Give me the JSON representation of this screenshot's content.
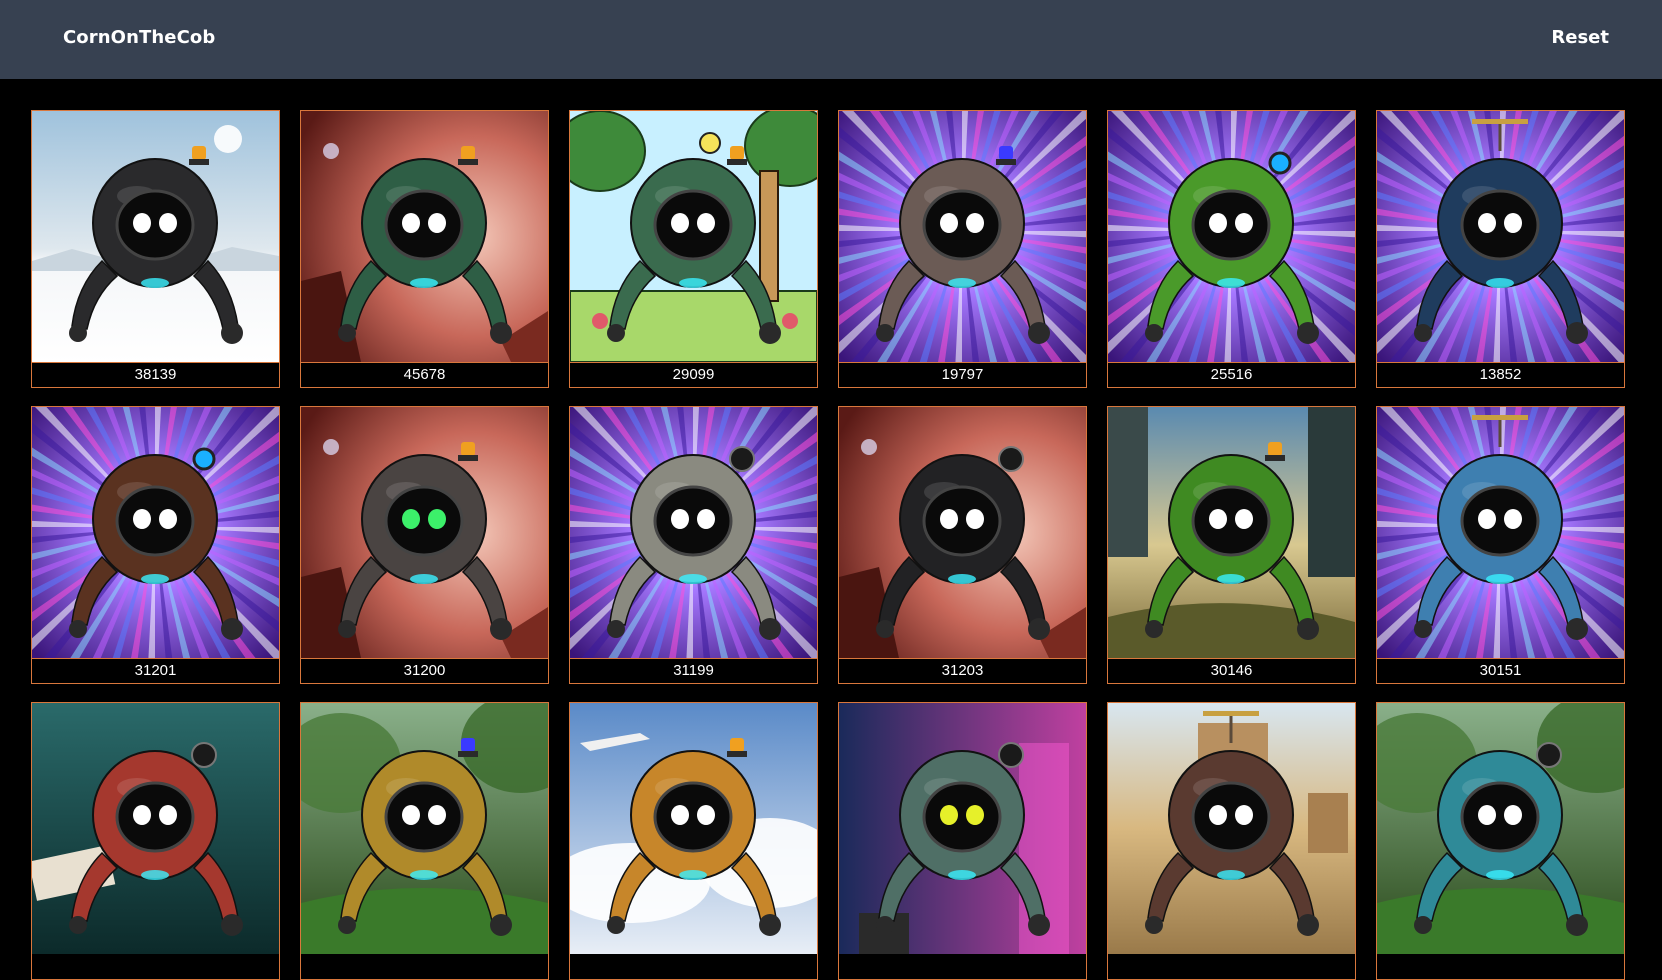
{
  "header": {
    "brand": "CornOnTheCob",
    "reset_label": "Reset"
  },
  "colors": {
    "header_bg": "#374151",
    "page_bg": "#000000",
    "card_border": "#d9773c"
  },
  "cards": [
    {
      "id": "38139",
      "bg": "snow",
      "body": "#2a2a2c",
      "eyes": "#ffffff",
      "accessory": "siren-orange"
    },
    {
      "id": "45678",
      "bg": "mars",
      "body": "#2e5e45",
      "eyes": "#ffffff",
      "accessory": "siren-orange"
    },
    {
      "id": "29099",
      "bg": "cartoon",
      "body": "#3a6b4e",
      "eyes": "#ffffff",
      "accessory": "siren-orange"
    },
    {
      "id": "19797",
      "bg": "hyperspace",
      "body": "#6b5b55",
      "eyes": "#ffffff",
      "accessory": "siren-blue"
    },
    {
      "id": "25516",
      "bg": "hyperspace",
      "body": "#4a9a2a",
      "eyes": "#ffffff",
      "accessory": "orb-blue"
    },
    {
      "id": "13852",
      "bg": "hyperspace",
      "body": "#1f3c5e",
      "eyes": "#ffffff",
      "accessory": "propeller"
    },
    {
      "id": "31201",
      "bg": "hyperspace",
      "body": "#5a3220",
      "eyes": "#ffffff",
      "accessory": "orb-blue"
    },
    {
      "id": "31200",
      "bg": "mars",
      "body": "#4a4442",
      "eyes": "#3cf06a",
      "accessory": "siren-orange"
    },
    {
      "id": "31199",
      "bg": "hyperspace",
      "body": "#8a8a80",
      "eyes": "#ffffff",
      "accessory": "orb-dark"
    },
    {
      "id": "31203",
      "bg": "mars",
      "body": "#222224",
      "eyes": "#ffffff",
      "accessory": "orb-dark"
    },
    {
      "id": "30146",
      "bg": "forest",
      "body": "#3f8a22",
      "eyes": "#ffffff",
      "accessory": "siren-orange"
    },
    {
      "id": "30151",
      "bg": "hyperspace",
      "body": "#3e7fb0",
      "eyes": "#ffffff",
      "accessory": "propeller"
    },
    {
      "id": "",
      "bg": "underwater",
      "body": "#a5382e",
      "eyes": "#ffffff",
      "accessory": "orb-dark"
    },
    {
      "id": "",
      "bg": "jungle",
      "body": "#b08a2a",
      "eyes": "#ffffff",
      "accessory": "siren-blue"
    },
    {
      "id": "",
      "bg": "sky",
      "body": "#c7862a",
      "eyes": "#ffffff",
      "accessory": "siren-orange"
    },
    {
      "id": "",
      "bg": "neon",
      "body": "#4f6f66",
      "eyes": "#e6f02a",
      "accessory": "orb-dark"
    },
    {
      "id": "",
      "bg": "desert",
      "body": "#5a3a30",
      "eyes": "#ffffff",
      "accessory": "propeller"
    },
    {
      "id": "",
      "bg": "jungle",
      "body": "#2f8a98",
      "eyes": "#ffffff",
      "accessory": "orb-dark"
    }
  ]
}
